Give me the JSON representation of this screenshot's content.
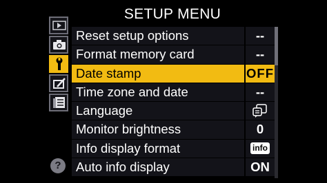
{
  "header": {
    "title": "SETUP MENU"
  },
  "sidebar": {
    "tabs": [
      {
        "name": "playback-tab",
        "icon": "playback-icon"
      },
      {
        "name": "shooting-tab",
        "icon": "camera-icon"
      },
      {
        "name": "setup-tab",
        "icon": "wrench-icon",
        "active": true
      },
      {
        "name": "retouch-tab",
        "icon": "retouch-brush-icon"
      },
      {
        "name": "recent-settings-tab",
        "icon": "recent-settings-icon"
      }
    ],
    "help": "?"
  },
  "menu": {
    "items": [
      {
        "label": "Reset setup options",
        "value": "--"
      },
      {
        "label": "Format memory card",
        "value": "--"
      },
      {
        "label": "Date stamp",
        "value": "OFF",
        "selected": true
      },
      {
        "label": "Time zone and date",
        "value": "--"
      },
      {
        "label": "Language",
        "value_icon": "language-icon"
      },
      {
        "label": "Monitor brightness",
        "value": "0"
      },
      {
        "label": "Info display format",
        "value_badge": "info"
      },
      {
        "label": "Auto info display",
        "value": "ON"
      }
    ]
  },
  "colors": {
    "highlight": "#f2bb12",
    "row_bg": "#131319",
    "background": "#000000"
  }
}
